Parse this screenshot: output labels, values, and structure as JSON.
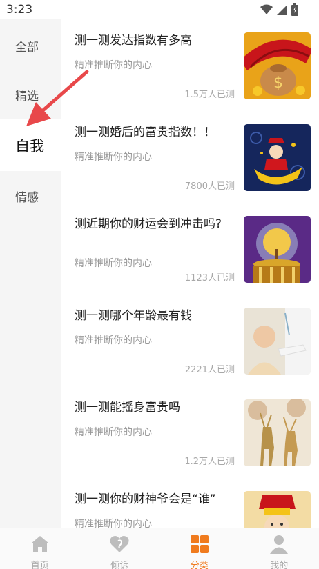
{
  "status_bar": {
    "time": "3:23"
  },
  "sidebar": {
    "items": [
      {
        "label": "全部"
      },
      {
        "label": "精选"
      },
      {
        "label": "自我"
      },
      {
        "label": "情感"
      }
    ],
    "selected": "自我"
  },
  "list": [
    {
      "title": "测一测发达指数有多高",
      "subtitle": "精准推断你的内心",
      "count": "1.5万人已测",
      "image": "lucky-bag-umbrella-image"
    },
    {
      "title": "测一测婚后的富贵指数！！",
      "subtitle": "精准推断你的内心",
      "count": "7800人已测",
      "image": "god-of-wealth-ingot-image"
    },
    {
      "title": "测近期你的财运会到冲击吗?",
      "subtitle": "精准推断你的内心",
      "count": "1123人已测",
      "image": "money-tree-globe-image"
    },
    {
      "title": "测一测哪个年龄最有钱",
      "subtitle": "精准推断你的内心",
      "count": "2221人已测",
      "image": "elderly-care-photo"
    },
    {
      "title": "测一测能摇身富贵吗",
      "subtitle": "精准推断你的内心",
      "count": "1.2万人已测",
      "image": "golden-deer-image"
    },
    {
      "title": "测一测你的财神爷会是“谁”",
      "subtitle": "精准推断你的内心",
      "count": "",
      "image": "god-of-wealth-face-image"
    }
  ],
  "tabbar": {
    "tabs": [
      {
        "label": "首页",
        "icon": "home-icon"
      },
      {
        "label": "倾诉",
        "icon": "heart-ear-icon"
      },
      {
        "label": "分类",
        "icon": "category-grid-icon"
      },
      {
        "label": "我的",
        "icon": "person-icon"
      }
    ],
    "active": "分类"
  },
  "colors": {
    "accent": "#f07b1e",
    "sidebar_bg": "#f5f5f5",
    "annotation_arrow": "#e8484a"
  }
}
